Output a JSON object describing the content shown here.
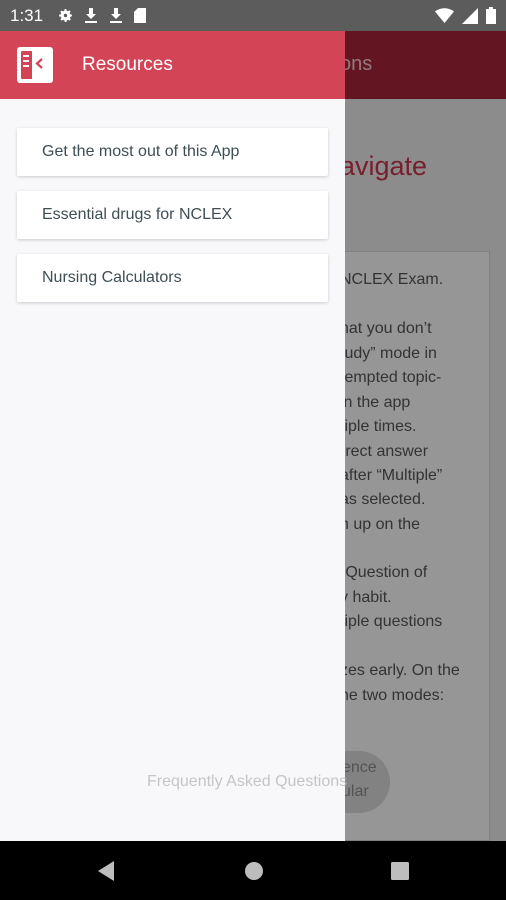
{
  "status_bar": {
    "time": "1:31",
    "left_icons": [
      "gear-icon",
      "download-icon",
      "download-icon",
      "sd-card-icon"
    ],
    "right_icons": [
      "wifi-icon",
      "signal-icon",
      "battery-icon"
    ]
  },
  "background": {
    "appbar_title": "ons",
    "heading": "avigate",
    "body_lines": [
      "NCLEX Exam.",
      "hat you don’t",
      "tudy” mode in",
      "tempted topic-",
      "in the app",
      "tiple times.",
      "rrect answer",
      "after “Multiple”",
      "as selected.",
      "h up on the",
      "(Question of",
      "y habit.",
      "tiple questions",
      "zes early. On the",
      "ne two modes:"
    ],
    "fab_lines": [
      "ence",
      "ular"
    ]
  },
  "drawer": {
    "title": "Resources",
    "logo_icon": "book-back-icon",
    "items": [
      {
        "label": "Get the most out of this App"
      },
      {
        "label": "Essential drugs for NCLEX"
      },
      {
        "label": "Nursing Calculators"
      }
    ],
    "faq_label": "Frequently Asked Questions"
  },
  "nav_bar": {
    "buttons": [
      "back-icon",
      "home-icon",
      "recents-icon"
    ]
  },
  "colors": {
    "drawer_header": "#d24456",
    "appbar": "#a6253a",
    "accent_text": "#c9354b"
  }
}
